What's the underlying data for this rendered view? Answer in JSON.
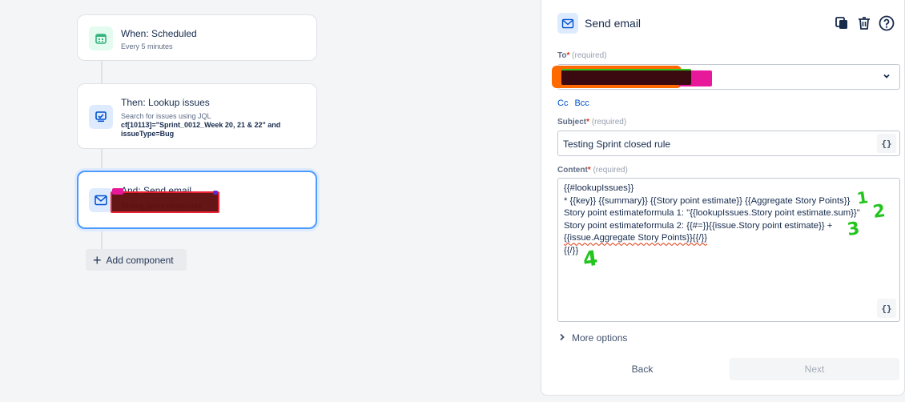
{
  "rule": {
    "trigger": {
      "icon": "calendar-icon",
      "title": "When: Scheduled",
      "subtitle": "Every 5 minutes"
    },
    "lookup": {
      "icon": "jql-search-icon",
      "title": "Then: Lookup issues",
      "subtitle": "Search for issues using JQL",
      "jql_line1": "cf[10113]=\"Sprint_0012_Week 20, 21 & 22\" and",
      "jql_line2": "issueType=Bug"
    },
    "action": {
      "icon": "mail-icon",
      "title": "And: Send email",
      "subtitle": "Testing Sprint closed rule"
    },
    "add_component": "Add component"
  },
  "panel": {
    "title": "Send email",
    "icon": "mail-icon",
    "to": {
      "label": "To",
      "required": "(required)"
    },
    "cc": "Cc",
    "bcc": "Bcc",
    "subject": {
      "label": "Subject",
      "required": "(required)",
      "value": "Testing Sprint closed rule"
    },
    "content": {
      "label": "Content",
      "required": "(required)",
      "lines": [
        "{{#lookupIssues}}",
        "* {{key}} {{summary}} {{Story point estimate}} {{Aggregate Story Points}}",
        "Story point estimateformula 1: \"{{lookupIssues.Story point estimate.sum}}\"",
        "Story point estimateformula 2: {{#=}}{{issue.Story point estimate}} +",
        "{{issue.Aggregate Story Points}}{{/}}",
        "{{/}}"
      ]
    },
    "braces_button": "{}",
    "more_options": "More options",
    "back_button": "Back",
    "next_button": "Next",
    "annotations": [
      "1",
      "2",
      "3",
      "4"
    ]
  },
  "colors": {
    "accent": "#0052cc",
    "selected_border": "#4c9aff",
    "annotation_green": "#22c41e",
    "required_red": "#de350b"
  }
}
